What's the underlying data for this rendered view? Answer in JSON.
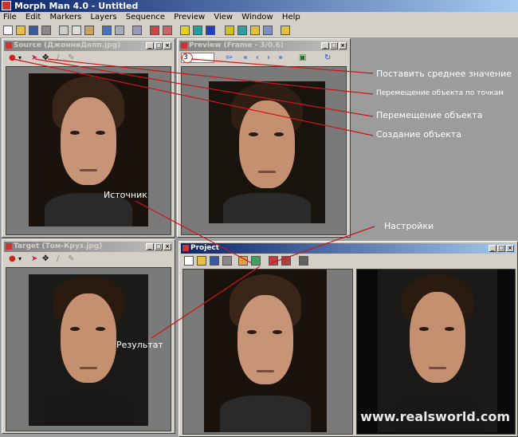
{
  "app": {
    "title": "Morph Man 4.0 - Untitled"
  },
  "menu": [
    "File",
    "Edit",
    "Markers",
    "Layers",
    "Sequence",
    "Preview",
    "View",
    "Window",
    "Help"
  ],
  "source_panel": {
    "title": "Source (ДжонниДепп.jpg)"
  },
  "preview_panel": {
    "title": "Preview (Frame - 3/0.6)",
    "frame_value": "3"
  },
  "target_panel": {
    "title": "Target (Том-Круз.jpg)"
  },
  "project_panel": {
    "title": "Project"
  },
  "annotations": {
    "average_value": "Поставить среднее значение",
    "move_by_points": "Перемещение объекта по точкам",
    "move_object": "Перемещение объекта",
    "create_object": "Создание объекта",
    "source": "Источник",
    "settings": "Настройки",
    "result": "Результат"
  },
  "watermark": "www.realsworld.com",
  "colors": {
    "annotation_line": "#c81818",
    "titlebar_active": "#0a246a",
    "titlebar_inactive": "#808080",
    "window_bg": "#d4d0c8"
  }
}
